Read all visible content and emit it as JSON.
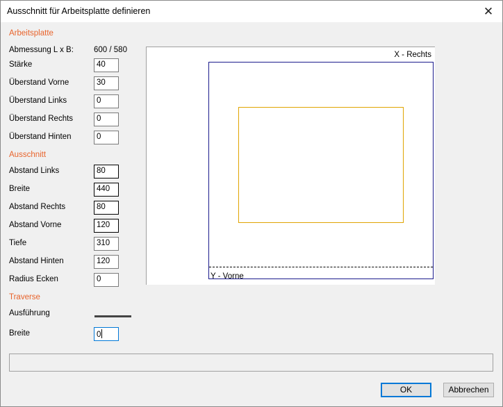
{
  "window": {
    "title": "Ausschnitt für Arbeitsplatte definieren"
  },
  "arbeitsplatte": {
    "heading": "Arbeitsplatte",
    "abmessung_label": "Abmessung L x B:",
    "abmessung_value": "600 / 580",
    "fields": [
      {
        "label": "Stärke",
        "value": "40"
      },
      {
        "label": "Überstand Vorne",
        "value": "30"
      },
      {
        "label": "Überstand Links",
        "value": "0"
      },
      {
        "label": "Überstand Rechts",
        "value": "0"
      },
      {
        "label": "Überstand Hinten",
        "value": "0"
      }
    ]
  },
  "ausschnitt": {
    "heading": "Ausschnitt",
    "fields": [
      {
        "label": "Abstand Links",
        "value": "80"
      },
      {
        "label": "Breite",
        "value": "440"
      },
      {
        "label": "Abstand Rechts",
        "value": "80"
      },
      {
        "label": "Abstand Vorne",
        "value": "120"
      },
      {
        "label": "Tiefe",
        "value": "310"
      },
      {
        "label": "Abstand Hinten",
        "value": "120"
      },
      {
        "label": "Radius Ecken",
        "value": "0"
      }
    ]
  },
  "traverse": {
    "heading": "Traverse",
    "ausfuehrung_label": "Ausführung",
    "breite_label": "Breite",
    "breite_value": "0"
  },
  "preview": {
    "x_label": "X - Rechts",
    "y_label": "Y - Vorne",
    "plate_color": "#1a1a8c",
    "cutout_color": "#e0a400"
  },
  "buttons": {
    "ok": "OK",
    "cancel": "Abbrechen"
  }
}
